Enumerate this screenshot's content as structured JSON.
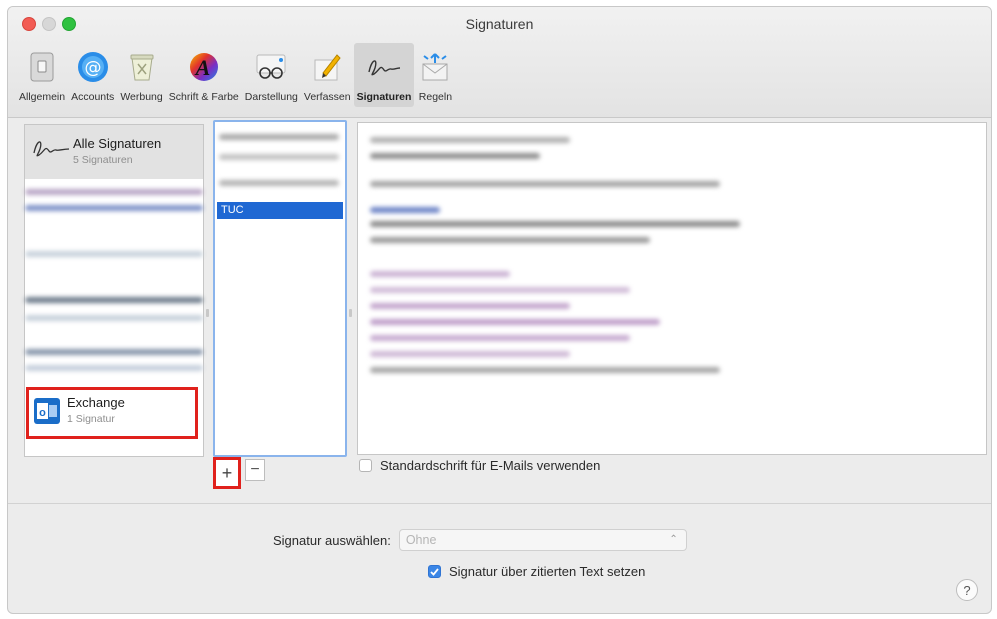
{
  "window": {
    "title": "Signaturen"
  },
  "toolbar": {
    "items": [
      {
        "label": "Allgemein",
        "icon": "switch-icon"
      },
      {
        "label": "Accounts",
        "icon": "at-icon"
      },
      {
        "label": "Werbung",
        "icon": "trash-bin-icon"
      },
      {
        "label": "Schrift & Farbe",
        "icon": "font-color-icon"
      },
      {
        "label": "Darstellung",
        "icon": "glasses-icon"
      },
      {
        "label": "Verfassen",
        "icon": "pencil-icon"
      },
      {
        "label": "Signaturen",
        "icon": "signature-icon",
        "selected": true
      },
      {
        "label": "Regeln",
        "icon": "rules-envelope-icon"
      }
    ]
  },
  "accounts": {
    "all": {
      "name": "Alle Signaturen",
      "count": "5 Signaturen"
    },
    "exchange": {
      "name": "Exchange",
      "count": "1 Signatur"
    }
  },
  "signatures": {
    "selected": "TUC"
  },
  "buttons": {
    "add": "+",
    "remove": "−",
    "help": "?"
  },
  "std_font": {
    "label": "Standardschrift für E-Mails verwenden",
    "checked": false
  },
  "select_signature": {
    "label": "Signatur auswählen:",
    "value": "Ohne"
  },
  "quote_option": {
    "label": "Signatur über zitierten Text setzen",
    "checked": true
  },
  "colors": {
    "selection": "#1f68d3",
    "highlight_border": "#e0211c",
    "focus_ring": "#8ab4ec"
  }
}
